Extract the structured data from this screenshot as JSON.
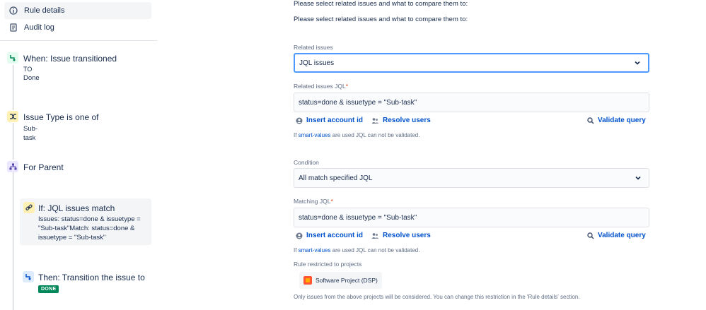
{
  "sidebar": {
    "nav": [
      {
        "label": "Rule details",
        "icon": "info-icon"
      },
      {
        "label": "Audit log",
        "icon": "document-icon"
      }
    ],
    "components": [
      {
        "type": "trigger",
        "title": "When: Issue transitioned",
        "sub1": "TO",
        "sub2": "Done",
        "icon": "trigger-icon",
        "color": "#e3fcef"
      },
      {
        "type": "condition",
        "title": "Issue Type is one of",
        "sub1": "Sub-task",
        "icon": "condition-shuffle-icon",
        "color": "#fff0b3"
      },
      {
        "type": "branch",
        "title": "For Parent",
        "icon": "branch-icon",
        "color": "#eae6ff"
      },
      {
        "type": "if",
        "title": "If: JQL issues match",
        "desc": "Issues: status=done & issuetype = \"Sub-task\"Match: status=done & issuetype = \"Sub-task\"",
        "icon": "link-icon",
        "color": "#fff0b3"
      },
      {
        "type": "action",
        "title": "Then: Transition the issue to",
        "badge": "DONE",
        "icon": "action-icon",
        "color": "#deebff"
      }
    ]
  },
  "main": {
    "prompt_top": "Please select related issues and what to compare them to:",
    "prompt": "Please select related issues and what to compare them to:",
    "related_issues_label": "Related issues",
    "related_issues_value": "JQL issues",
    "related_jql_label": "Related issues JQL",
    "related_jql_value": "status=done & issuetype = \"Sub-task\"",
    "insert_account_id": "Insert account id",
    "resolve_users": "Resolve users",
    "validate_query": "Validate query",
    "hint_prefix": "If ",
    "hint_link": "smart-values",
    "hint_suffix": " are used JQL can not be validated.",
    "condition_label": "Condition",
    "condition_value": "All match specified JQL",
    "matching_jql_label": "Matching JQL",
    "matching_jql_value": "status=done & issuetype = \"Sub-task\"",
    "restricted_label": "Rule restricted to projects",
    "project_name": "Software Project (DSP)",
    "restricted_note": "Only issues from the above projects will be considered. You can change this restriction in the 'Rule details' section.",
    "required_mark": "*"
  }
}
